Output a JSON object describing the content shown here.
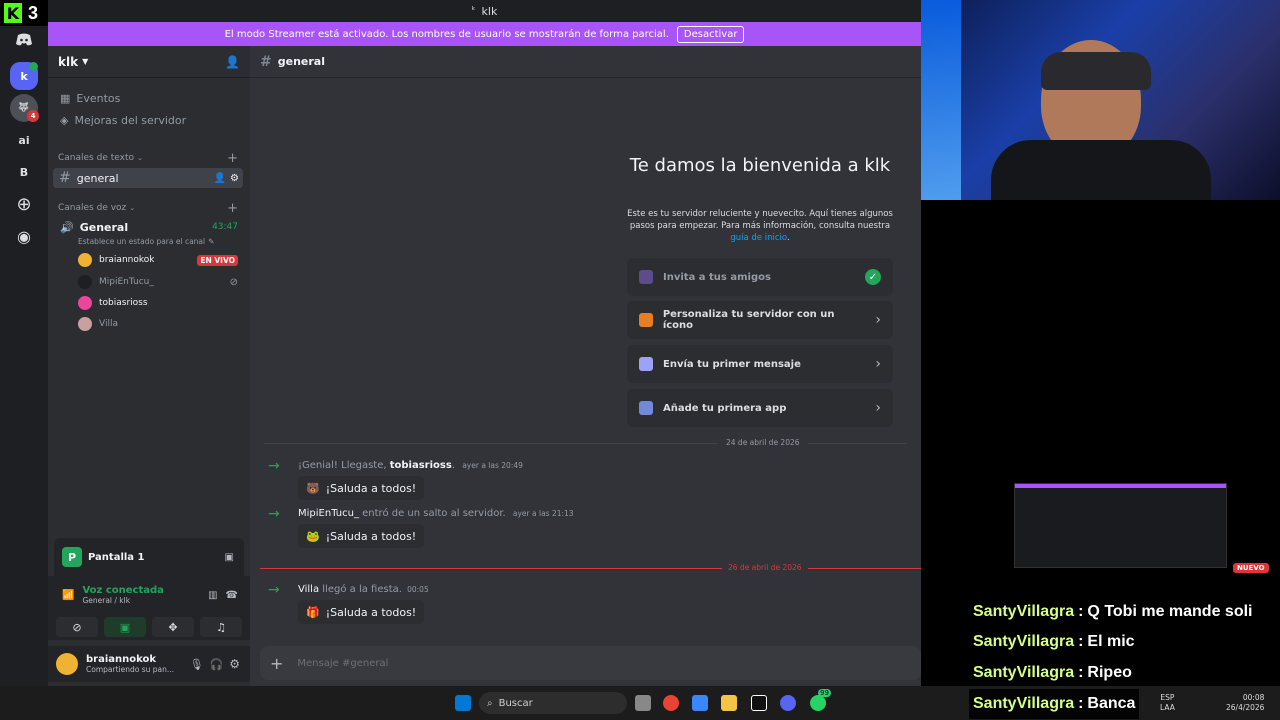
{
  "kick": {
    "logo_letter": "K",
    "number": "3"
  },
  "window": {
    "title": "klk"
  },
  "banner": {
    "text": "El modo Streamer está activado. Los nombres de usuario se mostrarán de forma parcial.",
    "button": "Desactivar"
  },
  "rail": {
    "items": [
      "k",
      "ai",
      "B"
    ]
  },
  "server": {
    "name": "klk"
  },
  "sidebar": {
    "events": "Eventos",
    "boosts": "Mejoras del servidor",
    "text_category": "Canales de texto",
    "text_channel": "general",
    "voice_category": "Canales de voz",
    "voice_channel": "General",
    "voice_timer": "43:47",
    "voice_status": "Establece un estado para el canal",
    "members": [
      {
        "name": "braiannokok",
        "badge": "EN VIVO"
      },
      {
        "name": "MipiEnTucu_"
      },
      {
        "name": "tobiasrioss"
      },
      {
        "name": "Villa"
      }
    ]
  },
  "screen_panel": {
    "title": "Pantalla 1"
  },
  "voice_panel": {
    "status": "Voz conectada",
    "location": "General / klk"
  },
  "user_panel": {
    "name": "braiannokok",
    "status": "Compartiendo su pan..."
  },
  "channel_header": {
    "name": "general"
  },
  "welcome": {
    "title": "Te damos la bienvenida a klk",
    "desc": "Este es tu servidor reluciente y nuevecito. Aquí tienes algunos pasos para empezar. Para más información, consulta nuestra",
    "link": "guía de inicio",
    "desc_end": ".",
    "cards": [
      "Invita a tus amigos",
      "Personaliza tu servidor con un ícono",
      "Envía tu primer mensaje",
      "Añade tu primera app"
    ]
  },
  "messages": {
    "date1": "24 de abril de 2026",
    "m1_pre": "¡Genial! Llegaste, ",
    "m1_user": "tobiasrioss",
    "m1_post": ".",
    "m1_time": "ayer a las 20:49",
    "wave": "¡Saluda a todos!",
    "m2_user": "MipiEnTucu_",
    "m2_text": "entró de un salto al servidor.",
    "m2_time": "ayer a las 21:13",
    "date2": "26 de abril de 2026",
    "m3_user": "Villa",
    "m3_text": "llegó a la fiesta.",
    "m3_time": "00:05"
  },
  "composer": {
    "placeholder": "Mensaje #general"
  },
  "overlay": {
    "nuevo": "NUEVO"
  },
  "stream_chat": [
    {
      "user": "SantyVillagra",
      "text": "Q Tobi me mande soli"
    },
    {
      "user": "SantyVillagra",
      "text": "El mic"
    },
    {
      "user": "SantyVillagra",
      "text": "Ripeo"
    },
    {
      "user": "SantyVillagra",
      "text": "Banca"
    }
  ],
  "taskbar": {
    "search": "Buscar",
    "lang1": "ESP",
    "lang2": "LAA",
    "time": "00:08",
    "date": "26/4/2026",
    "whatsapp_badge": "99"
  },
  "colors": {
    "accent": "#a855f7",
    "green": "#23a55a",
    "red": "#da373c",
    "kick": "#53fc18"
  }
}
